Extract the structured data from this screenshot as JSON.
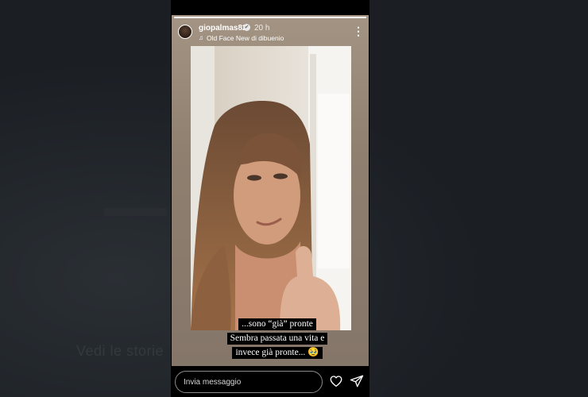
{
  "story": {
    "username": "giopalmas82",
    "time": "20 h",
    "song": "Old Face New di dibuenio",
    "progress": 1.0,
    "overlay_text": [
      "...sono “già” pronte",
      "Sembra passata una vita e",
      "invece già pronte... 🥹"
    ]
  },
  "background": {
    "ghost_text": "Vedi le storie"
  },
  "reply": {
    "placeholder": "Invia messaggio"
  },
  "icons": {
    "verified": "verified-badge-icon",
    "music": "music-note-icon",
    "more": "more-options-icon",
    "like": "heart-icon",
    "send": "send-icon"
  },
  "colors": {
    "accent": "#ffffff",
    "background": "#1b1f24",
    "story_bg": "#a39484"
  }
}
